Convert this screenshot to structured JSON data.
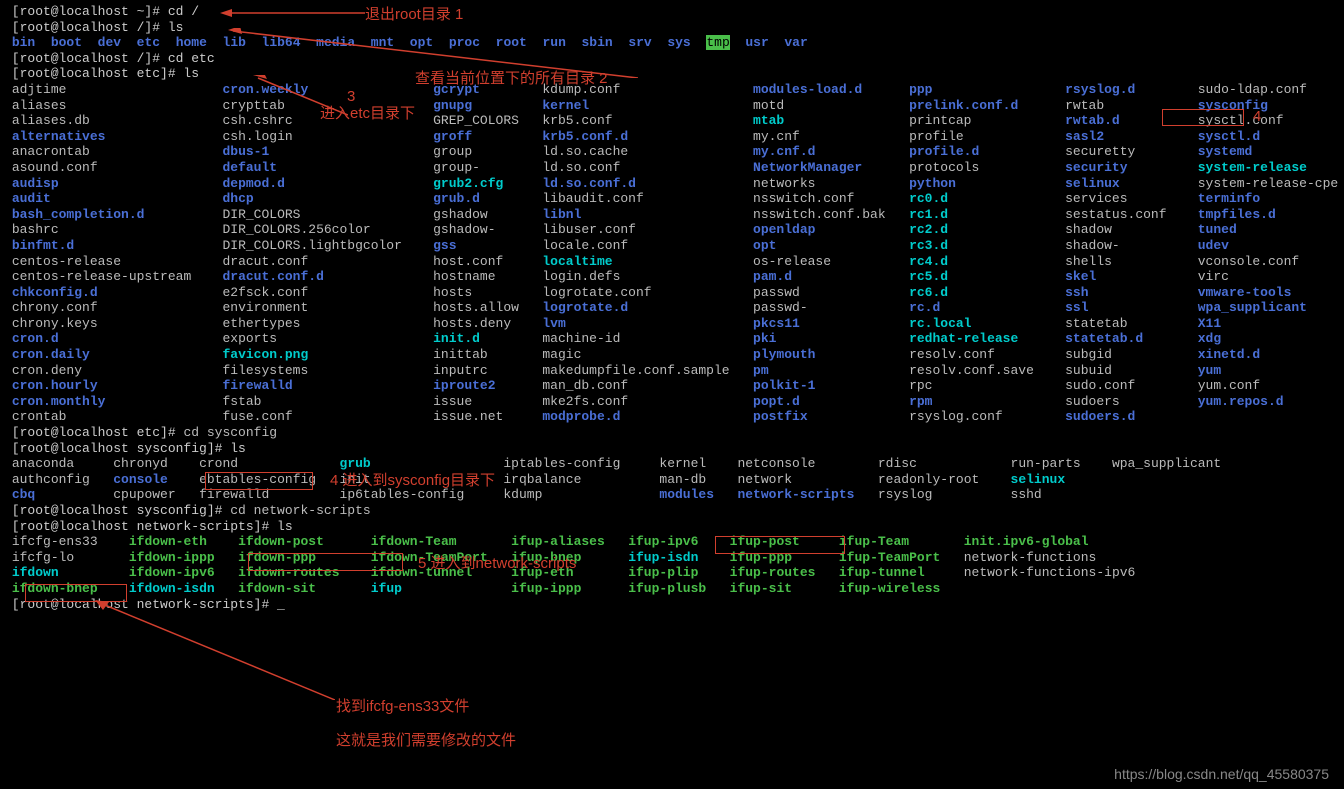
{
  "prompts": {
    "p1": "[root@localhost ~]# cd /",
    "p2": "[root@localhost /]# ls",
    "p3": "[root@localhost /]# cd etc",
    "p4": "[root@localhost etc]# ls",
    "p5_prefix": "[root@localhost etc]# ",
    "p5_cmd": "cd sysconfig",
    "p6": "[root@localhost sysconfig]# ls",
    "p7_prefix": "[root@localhost sysconfig]# ",
    "p7_cmd": "cd network-scripts",
    "p8": "[root@localhost network-scripts]# ls",
    "p9": "[root@localhost network-scripts]# _"
  },
  "root_ls": [
    "bin",
    "boot",
    "dev",
    "etc",
    "home",
    "lib",
    "lib64",
    "media",
    "mnt",
    "opt",
    "proc",
    "root",
    "run",
    "sbin",
    "srv",
    "sys",
    "tmp",
    "usr",
    "var"
  ],
  "etc_cols": [
    [
      {
        "t": "adjtime",
        "c": "file"
      },
      {
        "t": "aliases",
        "c": "file"
      },
      {
        "t": "aliases.db",
        "c": "file"
      },
      {
        "t": "alternatives",
        "c": "dir-blue"
      },
      {
        "t": "anacrontab",
        "c": "file"
      },
      {
        "t": "asound.conf",
        "c": "file"
      },
      {
        "t": "audisp",
        "c": "dir-blue"
      },
      {
        "t": "audit",
        "c": "dir-blue"
      },
      {
        "t": "bash_completion.d",
        "c": "dir-blue"
      },
      {
        "t": "bashrc",
        "c": "file"
      },
      {
        "t": "binfmt.d",
        "c": "dir-blue"
      },
      {
        "t": "centos-release",
        "c": "file"
      },
      {
        "t": "centos-release-upstream",
        "c": "file"
      },
      {
        "t": "chkconfig.d",
        "c": "dir-blue"
      },
      {
        "t": "chrony.conf",
        "c": "file"
      },
      {
        "t": "chrony.keys",
        "c": "file"
      },
      {
        "t": "cron.d",
        "c": "dir-blue"
      },
      {
        "t": "cron.daily",
        "c": "dir-blue"
      },
      {
        "t": "cron.deny",
        "c": "file"
      },
      {
        "t": "cron.hourly",
        "c": "dir-blue"
      },
      {
        "t": "cron.monthly",
        "c": "dir-blue"
      },
      {
        "t": "crontab",
        "c": "file"
      }
    ],
    [
      {
        "t": "cron.weekly",
        "c": "dir-blue"
      },
      {
        "t": "crypttab",
        "c": "file"
      },
      {
        "t": "csh.cshrc",
        "c": "file"
      },
      {
        "t": "csh.login",
        "c": "file"
      },
      {
        "t": "dbus-1",
        "c": "dir-blue"
      },
      {
        "t": "default",
        "c": "dir-blue"
      },
      {
        "t": "depmod.d",
        "c": "dir-blue"
      },
      {
        "t": "dhcp",
        "c": "dir-blue"
      },
      {
        "t": "DIR_COLORS",
        "c": "file"
      },
      {
        "t": "DIR_COLORS.256color",
        "c": "file"
      },
      {
        "t": "DIR_COLORS.lightbgcolor",
        "c": "file"
      },
      {
        "t": "dracut.conf",
        "c": "file"
      },
      {
        "t": "dracut.conf.d",
        "c": "dir-blue"
      },
      {
        "t": "e2fsck.conf",
        "c": "file"
      },
      {
        "t": "environment",
        "c": "file"
      },
      {
        "t": "ethertypes",
        "c": "file"
      },
      {
        "t": "exports",
        "c": "file"
      },
      {
        "t": "favicon.png",
        "c": "dir-cyan"
      },
      {
        "t": "filesystems",
        "c": "file"
      },
      {
        "t": "firewalld",
        "c": "dir-blue"
      },
      {
        "t": "fstab",
        "c": "file"
      },
      {
        "t": "fuse.conf",
        "c": "file"
      }
    ],
    [
      {
        "t": "gcrypt",
        "c": "dir-blue"
      },
      {
        "t": "gnupg",
        "c": "dir-blue"
      },
      {
        "t": "GREP_COLORS",
        "c": "file"
      },
      {
        "t": "groff",
        "c": "dir-blue"
      },
      {
        "t": "group",
        "c": "file"
      },
      {
        "t": "group-",
        "c": "file"
      },
      {
        "t": "grub2.cfg",
        "c": "dir-cyan"
      },
      {
        "t": "grub.d",
        "c": "dir-blue"
      },
      {
        "t": "gshadow",
        "c": "file"
      },
      {
        "t": "gshadow-",
        "c": "file"
      },
      {
        "t": "gss",
        "c": "dir-blue"
      },
      {
        "t": "host.conf",
        "c": "file"
      },
      {
        "t": "hostname",
        "c": "file"
      },
      {
        "t": "hosts",
        "c": "file"
      },
      {
        "t": "hosts.allow",
        "c": "file"
      },
      {
        "t": "hosts.deny",
        "c": "file"
      },
      {
        "t": "init.d",
        "c": "dir-cyan"
      },
      {
        "t": "inittab",
        "c": "file"
      },
      {
        "t": "inputrc",
        "c": "file"
      },
      {
        "t": "iproute2",
        "c": "dir-blue"
      },
      {
        "t": "issue",
        "c": "file"
      },
      {
        "t": "issue.net",
        "c": "file"
      }
    ],
    [
      {
        "t": "kdump.conf",
        "c": "file"
      },
      {
        "t": "kernel",
        "c": "dir-blue"
      },
      {
        "t": "krb5.conf",
        "c": "file"
      },
      {
        "t": "krb5.conf.d",
        "c": "dir-blue"
      },
      {
        "t": "ld.so.cache",
        "c": "file"
      },
      {
        "t": "ld.so.conf",
        "c": "file"
      },
      {
        "t": "ld.so.conf.d",
        "c": "dir-blue"
      },
      {
        "t": "libaudit.conf",
        "c": "file"
      },
      {
        "t": "libnl",
        "c": "dir-blue"
      },
      {
        "t": "libuser.conf",
        "c": "file"
      },
      {
        "t": "locale.conf",
        "c": "file"
      },
      {
        "t": "localtime",
        "c": "dir-cyan"
      },
      {
        "t": "login.defs",
        "c": "file"
      },
      {
        "t": "logrotate.conf",
        "c": "file"
      },
      {
        "t": "logrotate.d",
        "c": "dir-blue"
      },
      {
        "t": "lvm",
        "c": "dir-blue"
      },
      {
        "t": "machine-id",
        "c": "file"
      },
      {
        "t": "magic",
        "c": "file"
      },
      {
        "t": "makedumpfile.conf.sample",
        "c": "file"
      },
      {
        "t": "man_db.conf",
        "c": "file"
      },
      {
        "t": "mke2fs.conf",
        "c": "file"
      },
      {
        "t": "modprobe.d",
        "c": "dir-blue"
      }
    ],
    [
      {
        "t": "modules-load.d",
        "c": "dir-blue"
      },
      {
        "t": "motd",
        "c": "file"
      },
      {
        "t": "mtab",
        "c": "dir-cyan"
      },
      {
        "t": "my.cnf",
        "c": "file"
      },
      {
        "t": "my.cnf.d",
        "c": "dir-blue"
      },
      {
        "t": "NetworkManager",
        "c": "dir-blue"
      },
      {
        "t": "networks",
        "c": "file"
      },
      {
        "t": "nsswitch.conf",
        "c": "file"
      },
      {
        "t": "nsswitch.conf.bak",
        "c": "file"
      },
      {
        "t": "openldap",
        "c": "dir-blue"
      },
      {
        "t": "opt",
        "c": "dir-blue"
      },
      {
        "t": "os-release",
        "c": "file"
      },
      {
        "t": "pam.d",
        "c": "dir-blue"
      },
      {
        "t": "passwd",
        "c": "file"
      },
      {
        "t": "passwd-",
        "c": "file"
      },
      {
        "t": "pkcs11",
        "c": "dir-blue"
      },
      {
        "t": "pki",
        "c": "dir-blue"
      },
      {
        "t": "plymouth",
        "c": "dir-blue"
      },
      {
        "t": "pm",
        "c": "dir-blue"
      },
      {
        "t": "polkit-1",
        "c": "dir-blue"
      },
      {
        "t": "popt.d",
        "c": "dir-blue"
      },
      {
        "t": "postfix",
        "c": "dir-blue"
      }
    ],
    [
      {
        "t": "ppp",
        "c": "dir-blue"
      },
      {
        "t": "prelink.conf.d",
        "c": "dir-blue"
      },
      {
        "t": "printcap",
        "c": "file"
      },
      {
        "t": "profile",
        "c": "file"
      },
      {
        "t": "profile.d",
        "c": "dir-blue"
      },
      {
        "t": "protocols",
        "c": "file"
      },
      {
        "t": "python",
        "c": "dir-blue"
      },
      {
        "t": "rc0.d",
        "c": "dir-cyan"
      },
      {
        "t": "rc1.d",
        "c": "dir-cyan"
      },
      {
        "t": "rc2.d",
        "c": "dir-cyan"
      },
      {
        "t": "rc3.d",
        "c": "dir-cyan"
      },
      {
        "t": "rc4.d",
        "c": "dir-cyan"
      },
      {
        "t": "rc5.d",
        "c": "dir-cyan"
      },
      {
        "t": "rc6.d",
        "c": "dir-cyan"
      },
      {
        "t": "rc.d",
        "c": "dir-blue"
      },
      {
        "t": "rc.local",
        "c": "dir-cyan"
      },
      {
        "t": "redhat-release",
        "c": "dir-cyan"
      },
      {
        "t": "resolv.conf",
        "c": "file"
      },
      {
        "t": "resolv.conf.save",
        "c": "file"
      },
      {
        "t": "rpc",
        "c": "file"
      },
      {
        "t": "rpm",
        "c": "dir-blue"
      },
      {
        "t": "rsyslog.conf",
        "c": "file"
      }
    ],
    [
      {
        "t": "rsyslog.d",
        "c": "dir-blue"
      },
      {
        "t": "rwtab",
        "c": "file"
      },
      {
        "t": "rwtab.d",
        "c": "dir-blue"
      },
      {
        "t": "sasl2",
        "c": "dir-blue"
      },
      {
        "t": "securetty",
        "c": "file"
      },
      {
        "t": "security",
        "c": "dir-blue"
      },
      {
        "t": "selinux",
        "c": "dir-blue"
      },
      {
        "t": "services",
        "c": "file"
      },
      {
        "t": "sestatus.conf",
        "c": "file"
      },
      {
        "t": "shadow",
        "c": "file"
      },
      {
        "t": "shadow-",
        "c": "file"
      },
      {
        "t": "shells",
        "c": "file"
      },
      {
        "t": "skel",
        "c": "dir-blue"
      },
      {
        "t": "ssh",
        "c": "dir-blue"
      },
      {
        "t": "ssl",
        "c": "dir-blue"
      },
      {
        "t": "statetab",
        "c": "file"
      },
      {
        "t": "statetab.d",
        "c": "dir-blue"
      },
      {
        "t": "subgid",
        "c": "file"
      },
      {
        "t": "subuid",
        "c": "file"
      },
      {
        "t": "sudo.conf",
        "c": "file"
      },
      {
        "t": "sudoers",
        "c": "file"
      },
      {
        "t": "sudoers.d",
        "c": "dir-blue"
      }
    ],
    [
      {
        "t": "sudo-ldap.conf",
        "c": "file"
      },
      {
        "t": "sysconfig",
        "c": "dir-blue"
      },
      {
        "t": "sysctl.conf",
        "c": "file"
      },
      {
        "t": "sysctl.d",
        "c": "dir-blue"
      },
      {
        "t": "systemd",
        "c": "dir-blue"
      },
      {
        "t": "system-release",
        "c": "dir-cyan"
      },
      {
        "t": "system-release-cpe",
        "c": "file"
      },
      {
        "t": "terminfo",
        "c": "dir-blue"
      },
      {
        "t": "tmpfiles.d",
        "c": "dir-blue"
      },
      {
        "t": "tuned",
        "c": "dir-blue"
      },
      {
        "t": "udev",
        "c": "dir-blue"
      },
      {
        "t": "vconsole.conf",
        "c": "file"
      },
      {
        "t": "virc",
        "c": "file"
      },
      {
        "t": "vmware-tools",
        "c": "dir-blue"
      },
      {
        "t": "wpa_supplicant",
        "c": "dir-blue"
      },
      {
        "t": "X11",
        "c": "dir-blue"
      },
      {
        "t": "xdg",
        "c": "dir-blue"
      },
      {
        "t": "xinetd.d",
        "c": "dir-blue"
      },
      {
        "t": "yum",
        "c": "dir-blue"
      },
      {
        "t": "yum.conf",
        "c": "file"
      },
      {
        "t": "yum.repos.d",
        "c": "dir-blue"
      }
    ]
  ],
  "sysconfig_cols": [
    [
      {
        "t": "anaconda",
        "c": "file"
      },
      {
        "t": "authconfig",
        "c": "file"
      },
      {
        "t": "cbq",
        "c": "dir-blue"
      }
    ],
    [
      {
        "t": "chronyd",
        "c": "file"
      },
      {
        "t": "console",
        "c": "dir-blue"
      },
      {
        "t": "cpupower",
        "c": "file"
      }
    ],
    [
      {
        "t": "crond",
        "c": "file"
      },
      {
        "t": "ebtables-config",
        "c": "file"
      },
      {
        "t": "firewalld",
        "c": "file"
      }
    ],
    [
      {
        "t": "grub",
        "c": "dir-cyan"
      },
      {
        "t": "init",
        "c": "file"
      },
      {
        "t": "ip6tables-config",
        "c": "file"
      }
    ],
    [
      {
        "t": "iptables-config",
        "c": "file"
      },
      {
        "t": "irqbalance",
        "c": "file"
      },
      {
        "t": "kdump",
        "c": "file"
      }
    ],
    [
      {
        "t": "kernel",
        "c": "file"
      },
      {
        "t": "man-db",
        "c": "file"
      },
      {
        "t": "modules",
        "c": "dir-blue"
      }
    ],
    [
      {
        "t": "netconsole",
        "c": "file"
      },
      {
        "t": "network",
        "c": "file"
      },
      {
        "t": "network-scripts",
        "c": "dir-blue"
      }
    ],
    [
      {
        "t": "rdisc",
        "c": "file"
      },
      {
        "t": "readonly-root",
        "c": "file"
      },
      {
        "t": "rsyslog",
        "c": "file"
      }
    ],
    [
      {
        "t": "run-parts",
        "c": "file"
      },
      {
        "t": "selinux",
        "c": "dir-cyan"
      },
      {
        "t": "sshd",
        "c": "file"
      }
    ],
    [
      {
        "t": "wpa_supplicant",
        "c": "file"
      }
    ]
  ],
  "ns_cols": [
    [
      {
        "t": "ifcfg-ens33",
        "c": "file"
      },
      {
        "t": "ifcfg-lo",
        "c": "file"
      },
      {
        "t": "ifdown",
        "c": "dir-cyan"
      },
      {
        "t": "ifdown-bnep",
        "c": "exec"
      }
    ],
    [
      {
        "t": "ifdown-eth",
        "c": "exec"
      },
      {
        "t": "ifdown-ippp",
        "c": "exec"
      },
      {
        "t": "ifdown-ipv6",
        "c": "exec"
      },
      {
        "t": "ifdown-isdn",
        "c": "dir-cyan"
      }
    ],
    [
      {
        "t": "ifdown-post",
        "c": "exec"
      },
      {
        "t": "ifdown-ppp",
        "c": "exec"
      },
      {
        "t": "ifdown-routes",
        "c": "exec"
      },
      {
        "t": "ifdown-sit",
        "c": "exec"
      }
    ],
    [
      {
        "t": "ifdown-Team",
        "c": "exec"
      },
      {
        "t": "ifdown-TeamPort",
        "c": "exec"
      },
      {
        "t": "ifdown-tunnel",
        "c": "exec"
      },
      {
        "t": "ifup",
        "c": "dir-cyan"
      }
    ],
    [
      {
        "t": "ifup-aliases",
        "c": "exec"
      },
      {
        "t": "ifup-bnep",
        "c": "exec"
      },
      {
        "t": "ifup-eth",
        "c": "exec"
      },
      {
        "t": "ifup-ippp",
        "c": "exec"
      }
    ],
    [
      {
        "t": "ifup-ipv6",
        "c": "exec"
      },
      {
        "t": "ifup-isdn",
        "c": "dir-cyan"
      },
      {
        "t": "ifup-plip",
        "c": "exec"
      },
      {
        "t": "ifup-plusb",
        "c": "exec"
      }
    ],
    [
      {
        "t": "ifup-post",
        "c": "exec"
      },
      {
        "t": "ifup-ppp",
        "c": "exec"
      },
      {
        "t": "ifup-routes",
        "c": "exec"
      },
      {
        "t": "ifup-sit",
        "c": "exec"
      }
    ],
    [
      {
        "t": "ifup-Team",
        "c": "exec"
      },
      {
        "t": "ifup-TeamPort",
        "c": "exec"
      },
      {
        "t": "ifup-tunnel",
        "c": "exec"
      },
      {
        "t": "ifup-wireless",
        "c": "exec"
      }
    ],
    [
      {
        "t": "init.ipv6-global",
        "c": "exec"
      },
      {
        "t": "network-functions",
        "c": "file"
      },
      {
        "t": "network-functions-ipv6",
        "c": "file"
      }
    ]
  ],
  "annotations": {
    "a1": "退出root目录      1",
    "a2": "查看当前位置下的所有目录       2",
    "a3": "3",
    "a3b": "进入etc目录下",
    "a4": "4",
    "a5": "4  进入到sysconfig目录下",
    "a6": "5 进入到network-scripts",
    "a7": "找到ifcfg-ens33文件",
    "a8": "这就是我们需要修改的文件"
  },
  "watermark": "https://blog.csdn.net/qq_45580375"
}
